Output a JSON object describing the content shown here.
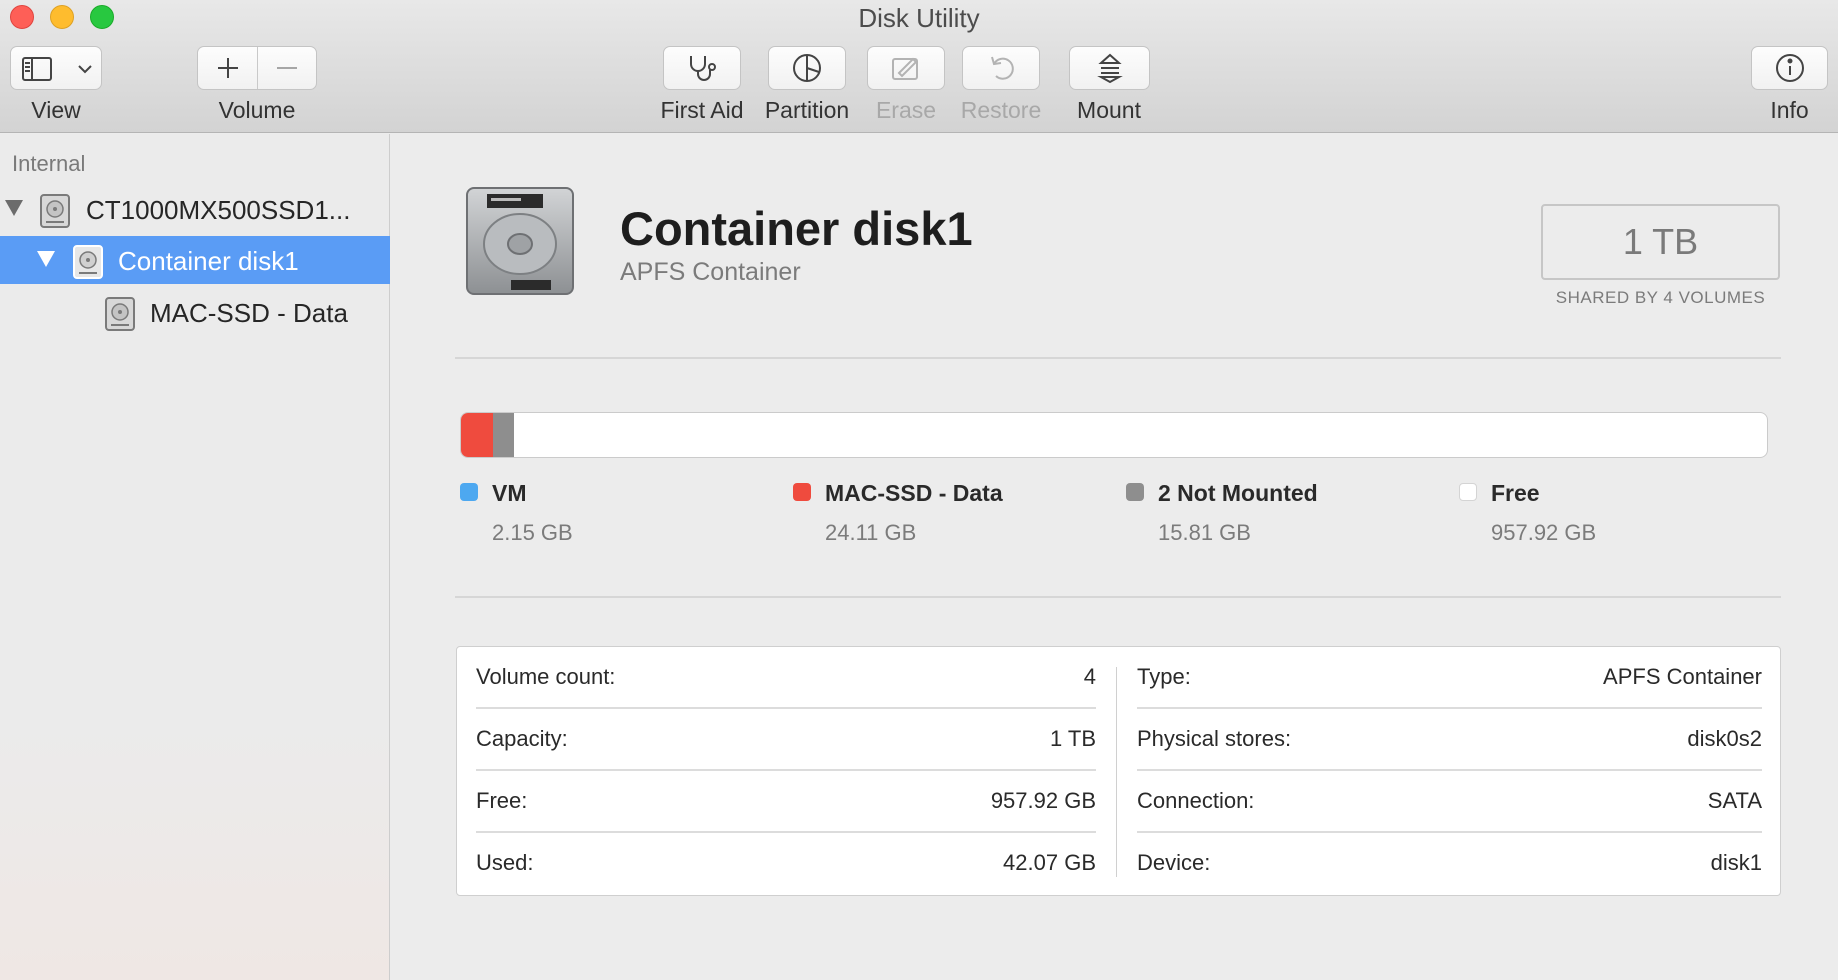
{
  "window": {
    "title": "Disk Utility"
  },
  "toolbar": {
    "view_label": "View",
    "volume_label": "Volume",
    "first_aid_label": "First Aid",
    "partition_label": "Partition",
    "erase_label": "Erase",
    "restore_label": "Restore",
    "mount_label": "Mount",
    "info_label": "Info",
    "icons": {
      "view": "sidebar-icon",
      "view_menu": "chevron-down-icon",
      "add_volume": "plus-icon",
      "remove_volume": "minus-icon",
      "first_aid": "stethoscope-icon",
      "partition": "pie-chart-icon",
      "erase": "eraser-icon",
      "restore": "restore-arrow-icon",
      "mount": "mount-icon",
      "info": "info-icon"
    }
  },
  "sidebar": {
    "section_header": "Internal",
    "items": [
      {
        "label": "CT1000MX500SSD1...",
        "icon": "hard-drive-icon",
        "selected": false
      },
      {
        "label": "Container disk1",
        "icon": "hard-drive-icon",
        "selected": true
      },
      {
        "label": "MAC-SSD - Data",
        "icon": "hard-drive-icon",
        "selected": false
      }
    ]
  },
  "main": {
    "title": "Container disk1",
    "subtitle": "APFS Container",
    "capacity": "1 TB",
    "capacity_note": "SHARED BY 4 VOLUMES",
    "usage": [
      {
        "name": "VM",
        "size": "2.15 GB",
        "gb": 2.15,
        "color": "#4da8f0"
      },
      {
        "name": "MAC-SSD - Data",
        "size": "24.11 GB",
        "gb": 24.11,
        "color": "#ef4b3e"
      },
      {
        "name": "2 Not Mounted",
        "size": "15.81 GB",
        "gb": 15.81,
        "color": "#8e8e8e"
      },
      {
        "name": "Free",
        "size": "957.92 GB",
        "gb": 957.92,
        "color": "#ffffff"
      }
    ],
    "info_left": [
      {
        "key": "Volume count:",
        "value": "4"
      },
      {
        "key": "Capacity:",
        "value": "1 TB"
      },
      {
        "key": "Free:",
        "value": "957.92 GB"
      },
      {
        "key": "Used:",
        "value": "42.07 GB"
      }
    ],
    "info_right": [
      {
        "key": "Type:",
        "value": "APFS Container"
      },
      {
        "key": "Physical stores:",
        "value": "disk0s2"
      },
      {
        "key": "Connection:",
        "value": "SATA"
      },
      {
        "key": "Device:",
        "value": "disk1"
      }
    ]
  }
}
